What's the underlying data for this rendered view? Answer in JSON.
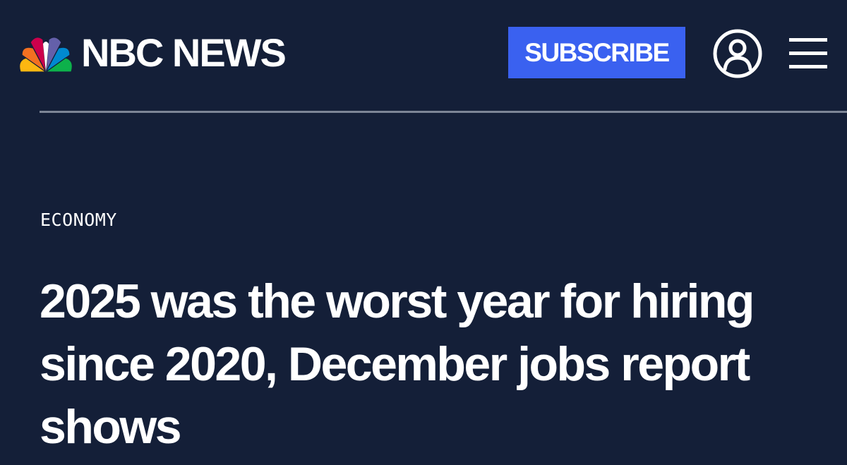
{
  "header": {
    "brand": "NBC NEWS",
    "subscribe_label": "SUBSCRIBE",
    "logo_icon": "nbc-peacock-logo",
    "account_icon": "user-account-icon",
    "menu_icon": "hamburger-menu-icon"
  },
  "article": {
    "section": "ECONOMY",
    "headline_lines": [
      "2025 was the worst year for hiring",
      "since 2020, December jobs report",
      "shows"
    ]
  },
  "colors": {
    "background": "#141f38",
    "subscribe_button": "#3a61f0",
    "text": "#ffffff",
    "divider": "#7d8596",
    "peacock": [
      "#fcb711",
      "#f37021",
      "#cc004c",
      "#6460aa",
      "#0089d0",
      "#0db14b"
    ]
  }
}
